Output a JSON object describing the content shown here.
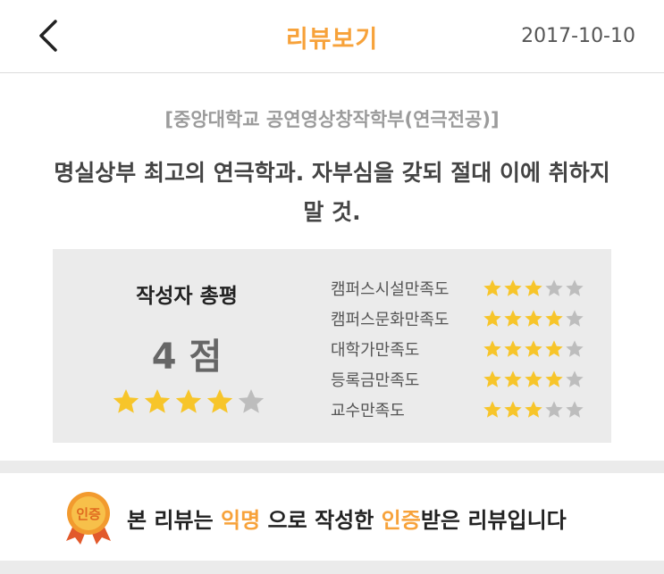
{
  "header": {
    "title": "리뷰보기",
    "date": "2017-10-10",
    "back_icon": "chevron-left-icon"
  },
  "review": {
    "school": "[중앙대학교 공연영상창작학부(연극전공)]",
    "title": "명실상부 최고의 연극학과. 자부심을 갖되 절대 이에 취하지 말 것."
  },
  "overall": {
    "label": "작성자 총평",
    "score_text": "4 점",
    "rating": 4,
    "max": 5
  },
  "categories": [
    {
      "label": "캠퍼스시설만족도",
      "rating": 3,
      "max": 5
    },
    {
      "label": "캠퍼스문화만족도",
      "rating": 4,
      "max": 5
    },
    {
      "label": "대학가만족도",
      "rating": 4,
      "max": 5
    },
    {
      "label": "등록금만족도",
      "rating": 4,
      "max": 5
    },
    {
      "label": "교수만족도",
      "rating": 3,
      "max": 5
    }
  ],
  "notice": {
    "badge_text": "인증",
    "part1": "본 리뷰는 ",
    "highlight1": "익명",
    "part2": " 으로 작성한 ",
    "highlight2": "인증",
    "part3": "받은 리뷰입니다"
  },
  "colors": {
    "accent": "#f7a23a",
    "star_on": "#f7c52a",
    "star_off": "#bdbdbd",
    "panel": "#ebebeb"
  }
}
